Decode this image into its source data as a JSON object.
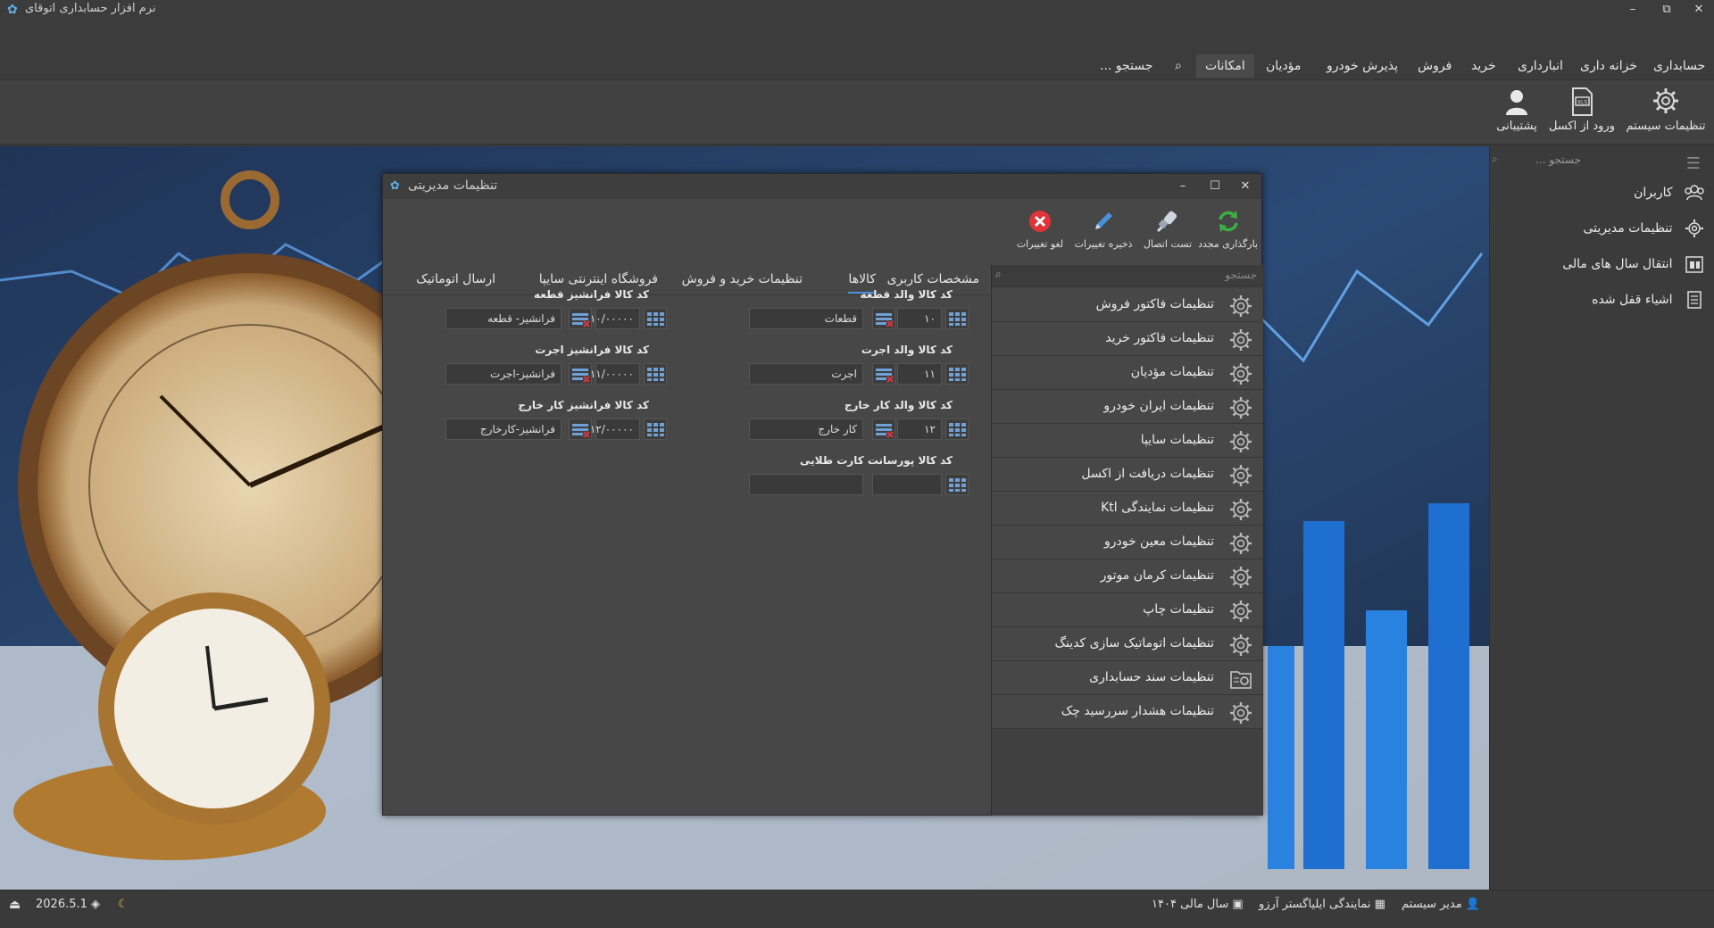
{
  "app": {
    "title": "نرم افزار حسابداری اتوقای"
  },
  "window_controls": {
    "minimize": "–",
    "restore": "⧉",
    "close": "✕"
  },
  "menu": {
    "items": [
      "حسابداری",
      "خزانه داری",
      "انبارداری",
      "خرید",
      "فروش",
      "پذیرش خودرو",
      "مؤدیان",
      "امکانات"
    ],
    "search_placeholder": "جستجو ..."
  },
  "ribbon": {
    "buttons": [
      "تنظیمات سیستم",
      "ورود از اکسل",
      "پشتیبانی"
    ]
  },
  "right_panel": {
    "search_placeholder": "جستجو ...",
    "items": [
      "کاربران",
      "تنظیمات مدیریتی",
      "انتقال سال های مالی",
      "اشیاء قفل شده"
    ]
  },
  "dialog": {
    "title": "تنظیمات مدیریتی",
    "controls": {
      "minimize": "–",
      "maximize": "☐",
      "close": "✕"
    },
    "toolbar": [
      "بارگذاری مجدد",
      "تست اتصال",
      "ذخیره تغییرات",
      "لغو تغییرات"
    ],
    "list_search_placeholder": "جستجو",
    "list_items": [
      "تنظیمات فاکتور فروش",
      "تنظیمات فاکتور خرید",
      "تنظیمات مؤدیان",
      "تنظیمات ایران خودرو",
      "تنظیمات سایپا",
      "تنظیمات دریافت از اکسل",
      "تنظیمات نمایندگی Ktl",
      "تنظیمات معین خودرو",
      "تنظیمات کرمان موتور",
      "تنظیمات چاپ",
      "تنظیمات اتوماتیک سازی کدینگ",
      "تنظیمات سند حسابداری",
      "تنظیمات هشدار سررسید چک"
    ],
    "tabs": [
      "مشخصات کاربری",
      "کالاها",
      "تنظیمات خرید و فروش",
      "فروشگاه اینترنتی سایپا",
      "ارسال اتوماتیک"
    ],
    "active_tab": "کالاها",
    "fields_right": [
      {
        "label": "کد کالا والد قطعه",
        "code": "۱۰",
        "name": "قطعات"
      },
      {
        "label": "کد کالا والد اجرت",
        "code": "۱۱",
        "name": "اجرت"
      },
      {
        "label": "کد کالا والد کار خارج",
        "code": "۱۲",
        "name": "کار خارج"
      },
      {
        "label": "کد کالا پورسانت کارت طلایی",
        "code": "",
        "name": ""
      }
    ],
    "fields_left": [
      {
        "label": "کد کالا فرانشیز قطعه",
        "code": "۱۰/۰۰۰۰۰",
        "name": "فرانشیز- قطعه"
      },
      {
        "label": "کد کالا فرانشیز اجرت",
        "code": "۱۱/۰۰۰۰۰",
        "name": "فرانشیز-اجرت"
      },
      {
        "label": "کد کالا فرانشیز کار خارج",
        "code": "۱۲/۰۰۰۰۰",
        "name": "فرانشیز-کارخارج"
      }
    ]
  },
  "statusbar": {
    "user": "مدیر سیستم",
    "dealer": "نمایندگی ایلیاگستر آرزو",
    "fiscal_year": "سال مالی ۱۴۰۴",
    "version": "2026.5.1"
  },
  "colors": {
    "accent": "#4a90d9",
    "reload_green": "#3cb043",
    "cancel_red": "#e0343a",
    "edit_blue": "#4a90d9"
  }
}
